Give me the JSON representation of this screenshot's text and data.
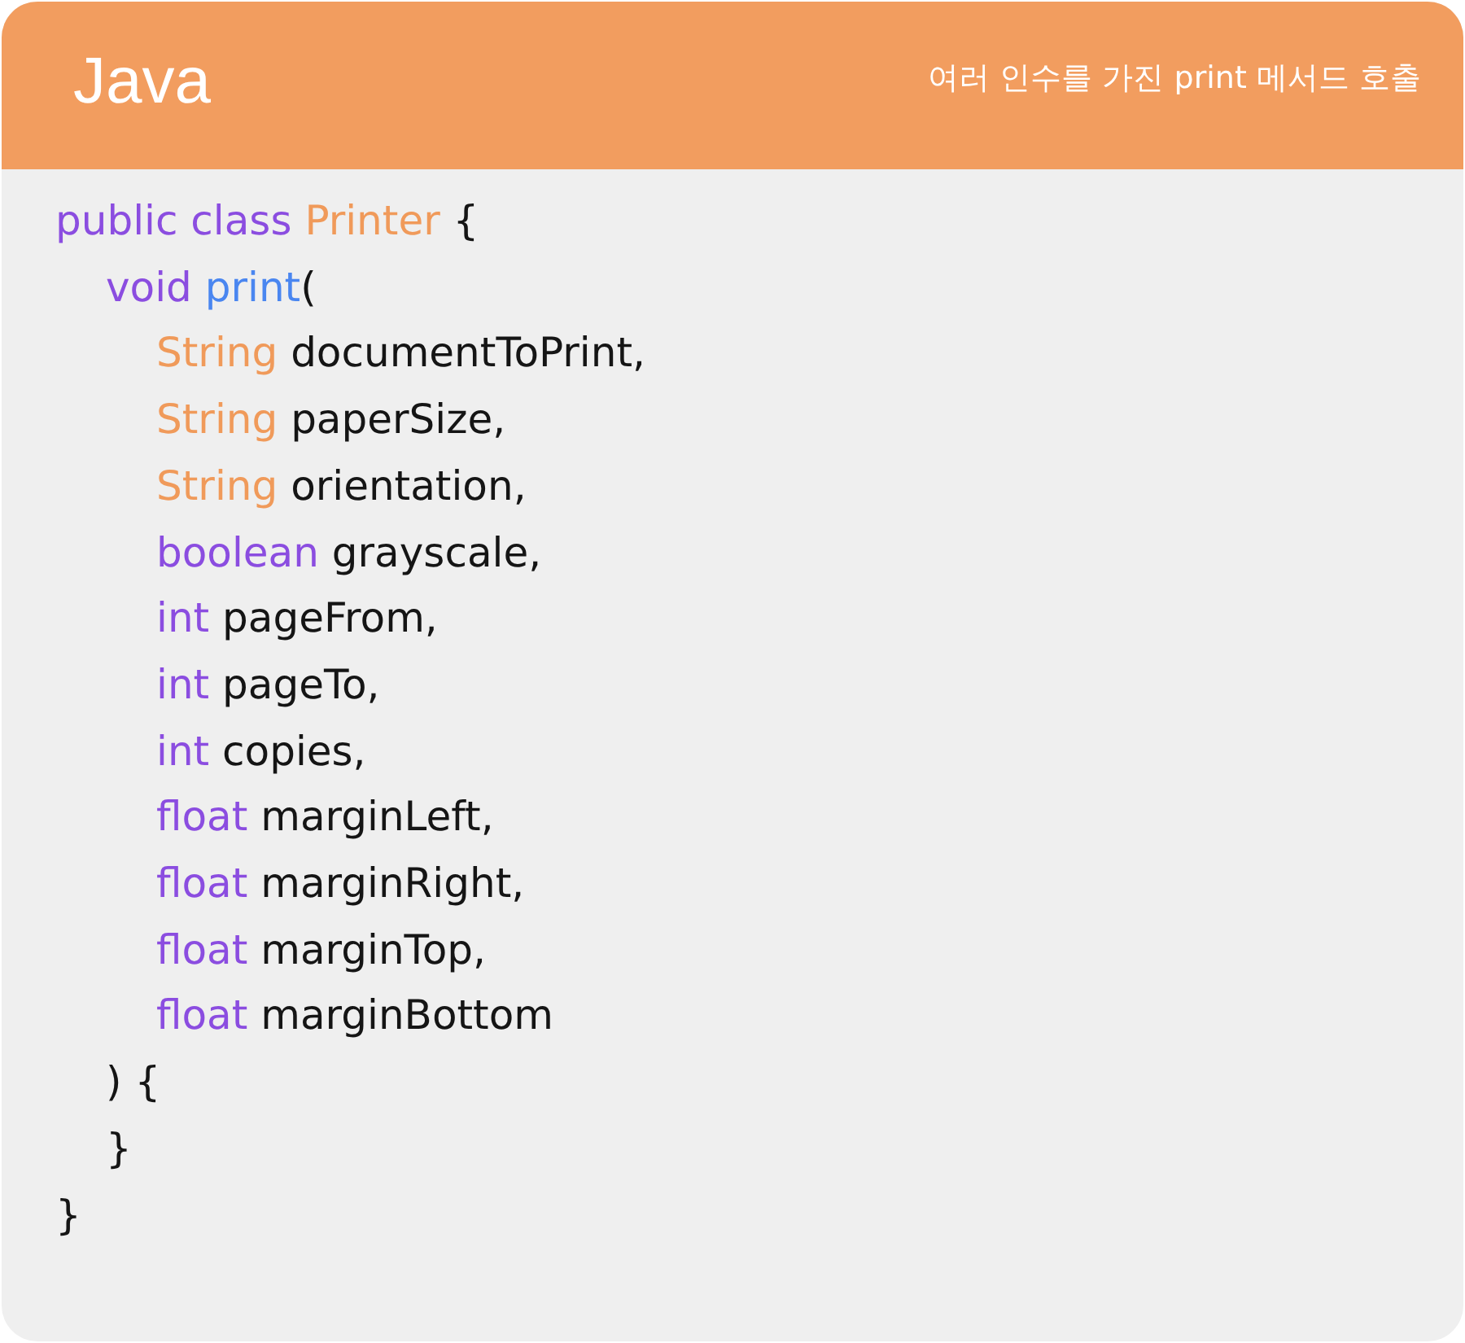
{
  "header": {
    "title": "Java",
    "subtitle": "여러 인수를 가진 print 메서드 호출"
  },
  "code": [
    {
      "tokens": [
        {
          "kind": "keyword",
          "text": "public class "
        },
        {
          "kind": "type",
          "text": "Printer"
        },
        {
          "kind": "plain",
          "text": " {"
        }
      ],
      "children": [
        {
          "tokens": [
            {
              "kind": "keyword",
              "text": "void "
            },
            {
              "kind": "method",
              "text": "print"
            },
            {
              "kind": "plain",
              "text": "("
            }
          ],
          "children": [
            {
              "tokens": [
                {
                  "kind": "type",
                  "text": "String "
                },
                {
                  "kind": "plain",
                  "text": "documentToPrint,"
                }
              ]
            },
            {
              "tokens": [
                {
                  "kind": "type",
                  "text": "String "
                },
                {
                  "kind": "plain",
                  "text": "paperSize,"
                }
              ]
            },
            {
              "tokens": [
                {
                  "kind": "type",
                  "text": "String "
                },
                {
                  "kind": "plain",
                  "text": "orientation,"
                }
              ]
            },
            {
              "tokens": [
                {
                  "kind": "keyword",
                  "text": "boolean "
                },
                {
                  "kind": "plain",
                  "text": "grayscale,"
                }
              ]
            },
            {
              "tokens": [
                {
                  "kind": "keyword",
                  "text": "int "
                },
                {
                  "kind": "plain",
                  "text": "pageFrom,"
                }
              ]
            },
            {
              "tokens": [
                {
                  "kind": "keyword",
                  "text": "int "
                },
                {
                  "kind": "plain",
                  "text": "pageTo,"
                }
              ]
            },
            {
              "tokens": [
                {
                  "kind": "keyword",
                  "text": "int "
                },
                {
                  "kind": "plain",
                  "text": "copies,"
                }
              ]
            },
            {
              "tokens": [
                {
                  "kind": "keyword",
                  "text": "float "
                },
                {
                  "kind": "plain",
                  "text": "marginLeft,"
                }
              ]
            },
            {
              "tokens": [
                {
                  "kind": "keyword",
                  "text": "float "
                },
                {
                  "kind": "plain",
                  "text": "marginRight,"
                }
              ]
            },
            {
              "tokens": [
                {
                  "kind": "keyword",
                  "text": "float "
                },
                {
                  "kind": "plain",
                  "text": "marginTop,"
                }
              ]
            },
            {
              "tokens": [
                {
                  "kind": "keyword",
                  "text": "float "
                },
                {
                  "kind": "plain",
                  "text": "marginBottom"
                }
              ]
            }
          ]
        },
        {
          "tokens": [
            {
              "kind": "plain",
              "text": ") {"
            }
          ]
        },
        {
          "tokens": [
            {
              "kind": "plain",
              "text": "}"
            }
          ]
        }
      ]
    },
    {
      "tokens": [
        {
          "kind": "plain",
          "text": "}"
        }
      ]
    }
  ]
}
